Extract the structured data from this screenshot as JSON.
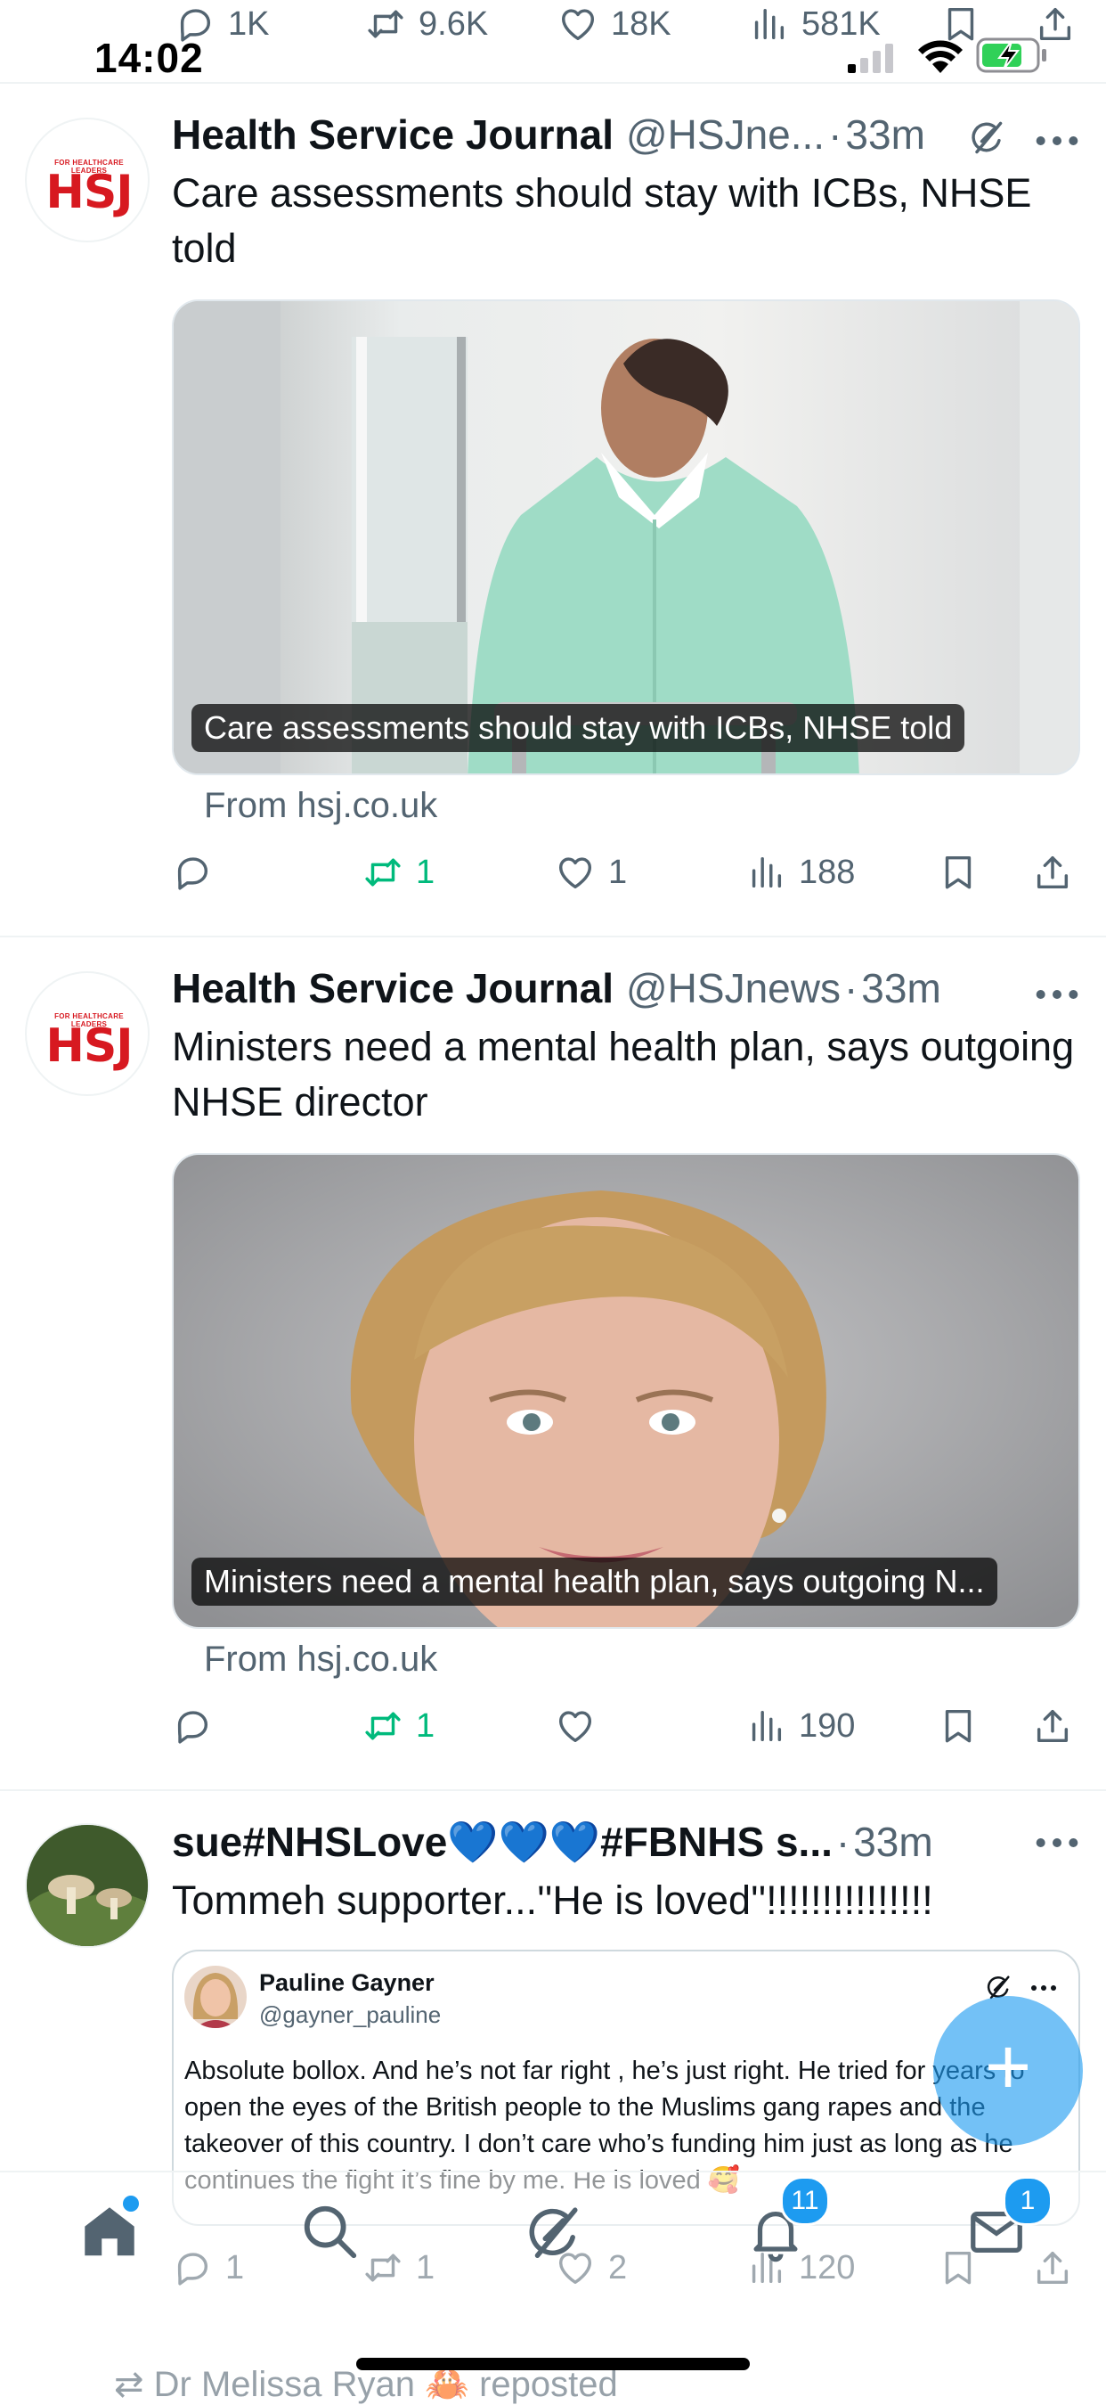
{
  "status_bar": {
    "time": "14:02"
  },
  "previous_tweet_actions": {
    "replies": "1K",
    "reposts": "9.6K",
    "likes": "18K",
    "views": "581K"
  },
  "tweets": [
    {
      "author_name": "Health Service Journal",
      "handle": "@HSJne...",
      "time": "33m",
      "text": "Care assessments should stay with ICBs, NHSE told",
      "media_caption": "Care assessments should stay with ICBs, NHSE told",
      "link_source": "From hsj.co.uk",
      "reposts": "1",
      "likes": "1",
      "views": "188",
      "avatar_label_small": "FOR HEALTHCARE LEADERS",
      "avatar_label": "HSJ"
    },
    {
      "author_name": "Health Service Journal",
      "handle": "@HSJnews",
      "time": "33m",
      "text": "Ministers need a mental health plan, says outgoing NHSE director",
      "media_caption": "Ministers need a mental health plan, says outgoing N...",
      "link_source": "From hsj.co.uk",
      "reposts": "1",
      "views": "190",
      "avatar_label_small": "FOR HEALTHCARE LEADERS",
      "avatar_label": "HSJ"
    },
    {
      "author_name": "sue#NHSLove💙💙💙#FBNHS s...",
      "time": "33m",
      "text": "Tommeh supporter...''He is loved''!!!!!!!!!!!!!!!",
      "quote": {
        "author_name": "Pauline Gayner",
        "handle": "@gayner_pauline",
        "text": "Absolute bollox. And he’s not far right , he’s just right. He tried for years to open the eyes of the British people to the Muslims gang rapes and the takeover of this country. I don’t care who’s funding him just as long as he continues the fight it’s fine by me. He is loved 🥰"
      },
      "replies": "1",
      "reposts": "1",
      "likes": "2",
      "views": "120"
    }
  ],
  "next_item": {
    "reposted_by": "Dr Melissa Ryan 🦀 reposted"
  },
  "fab": {
    "label": "+"
  },
  "bottom_nav": {
    "notifications_badge": "11",
    "messages_badge": "1"
  },
  "colors": {
    "accent": "#1d9bf0",
    "repost_green": "#00ba7c",
    "muted": "#536471",
    "hsj_red": "#d71920"
  }
}
